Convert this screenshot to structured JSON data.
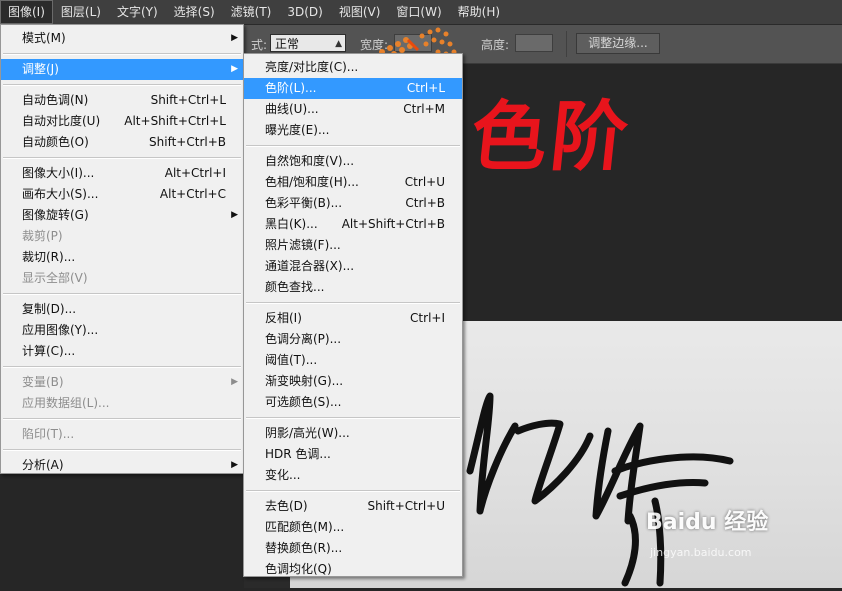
{
  "menubar": {
    "items": [
      "图像(I)",
      "图层(L)",
      "文字(Y)",
      "选择(S)",
      "滤镜(T)",
      "3D(D)",
      "视图(V)",
      "窗口(W)",
      "帮助(H)"
    ]
  },
  "options": {
    "mode_label_fragment": "式:",
    "mode_value": "正常",
    "width_label": "宽度:",
    "height_label": "高度:",
    "refine_button": "调整边缘..."
  },
  "canvas": {
    "title_text": "色阶",
    "watermark": "Baidu 经验",
    "watermark_url": "jingyan.baidu.com"
  },
  "image_menu": {
    "items": [
      {
        "label": "模式(M)",
        "shortcut": "",
        "submenu": true
      },
      {
        "sep": true
      },
      {
        "label": "调整(J)",
        "shortcut": "",
        "submenu": true,
        "highlight": true
      },
      {
        "sep": true
      },
      {
        "label": "自动色调(N)",
        "shortcut": "Shift+Ctrl+L"
      },
      {
        "label": "自动对比度(U)",
        "shortcut": "Alt+Shift+Ctrl+L"
      },
      {
        "label": "自动颜色(O)",
        "shortcut": "Shift+Ctrl+B"
      },
      {
        "sep": true
      },
      {
        "label": "图像大小(I)...",
        "shortcut": "Alt+Ctrl+I"
      },
      {
        "label": "画布大小(S)...",
        "shortcut": "Alt+Ctrl+C"
      },
      {
        "label": "图像旋转(G)",
        "shortcut": "",
        "submenu": true
      },
      {
        "label": "裁剪(P)",
        "shortcut": "",
        "disabled": true
      },
      {
        "label": "裁切(R)...",
        "shortcut": ""
      },
      {
        "label": "显示全部(V)",
        "shortcut": "",
        "disabled": true
      },
      {
        "sep": true
      },
      {
        "label": "复制(D)...",
        "shortcut": ""
      },
      {
        "label": "应用图像(Y)...",
        "shortcut": ""
      },
      {
        "label": "计算(C)...",
        "shortcut": ""
      },
      {
        "sep": true
      },
      {
        "label": "变量(B)",
        "shortcut": "",
        "submenu": true,
        "disabled": true
      },
      {
        "label": "应用数据组(L)...",
        "shortcut": "",
        "disabled": true
      },
      {
        "sep": true
      },
      {
        "label": "陷印(T)...",
        "shortcut": "",
        "disabled": true
      },
      {
        "sep": true
      },
      {
        "label": "分析(A)",
        "shortcut": "",
        "submenu": true
      }
    ]
  },
  "adjust_menu": {
    "items": [
      {
        "label": "亮度/对比度(C)...",
        "shortcut": ""
      },
      {
        "label": "色阶(L)...",
        "shortcut": "Ctrl+L",
        "highlight": true
      },
      {
        "label": "曲线(U)...",
        "shortcut": "Ctrl+M"
      },
      {
        "label": "曝光度(E)...",
        "shortcut": ""
      },
      {
        "sep": true
      },
      {
        "label": "自然饱和度(V)...",
        "shortcut": ""
      },
      {
        "label": "色相/饱和度(H)...",
        "shortcut": "Ctrl+U"
      },
      {
        "label": "色彩平衡(B)...",
        "shortcut": "Ctrl+B"
      },
      {
        "label": "黑白(K)...",
        "shortcut": "Alt+Shift+Ctrl+B"
      },
      {
        "label": "照片滤镜(F)...",
        "shortcut": ""
      },
      {
        "label": "通道混合器(X)...",
        "shortcut": ""
      },
      {
        "label": "颜色查找...",
        "shortcut": ""
      },
      {
        "sep": true
      },
      {
        "label": "反相(I)",
        "shortcut": "Ctrl+I"
      },
      {
        "label": "色调分离(P)...",
        "shortcut": ""
      },
      {
        "label": "阈值(T)...",
        "shortcut": ""
      },
      {
        "label": "渐变映射(G)...",
        "shortcut": ""
      },
      {
        "label": "可选颜色(S)...",
        "shortcut": ""
      },
      {
        "sep": true
      },
      {
        "label": "阴影/高光(W)...",
        "shortcut": ""
      },
      {
        "label": "HDR 色调...",
        "shortcut": ""
      },
      {
        "label": "变化...",
        "shortcut": ""
      },
      {
        "sep": true
      },
      {
        "label": "去色(D)",
        "shortcut": "Shift+Ctrl+U"
      },
      {
        "label": "匹配颜色(M)...",
        "shortcut": ""
      },
      {
        "label": "替换颜色(R)...",
        "shortcut": ""
      },
      {
        "label": "色调均化(Q)",
        "shortcut": ""
      }
    ]
  }
}
